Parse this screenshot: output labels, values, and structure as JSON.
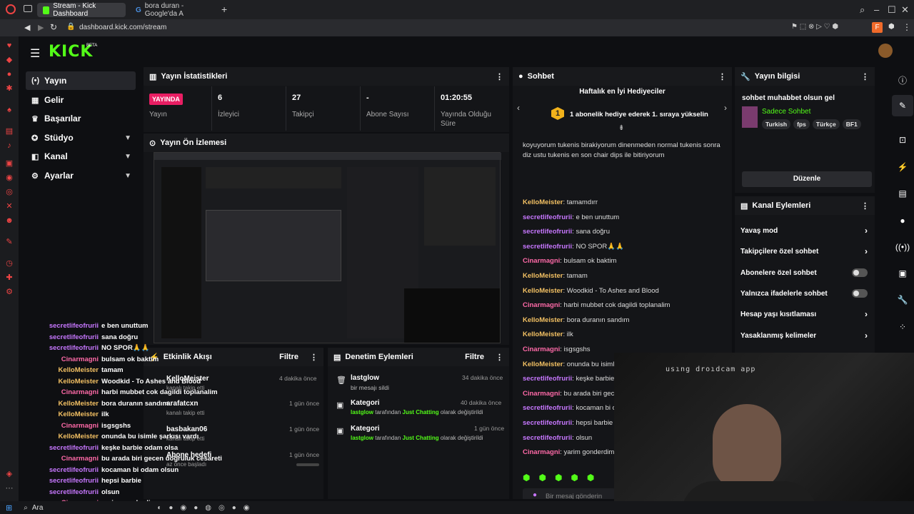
{
  "browser": {
    "tabs": [
      {
        "label": "Stream - Kick Dashboard"
      },
      {
        "label": "bora duran - Google'da A"
      }
    ],
    "url": "dashboard.kick.com/stream",
    "profile_initial": "F"
  },
  "kick": {
    "logo": "KICK",
    "beta": "BETA"
  },
  "nav": [
    {
      "label": "Yayın"
    },
    {
      "label": "Gelir"
    },
    {
      "label": "Başarılar"
    },
    {
      "label": "Stüdyo"
    },
    {
      "label": "Kanal"
    },
    {
      "label": "Ayarlar"
    }
  ],
  "stats": {
    "title": "Yayın İstatistikleri",
    "live_badge": "YAYINDA",
    "live_label": "Yayın",
    "viewers_value": "6",
    "viewers_label": "İzleyici",
    "followers_value": "27",
    "followers_label": "Takipçi",
    "subs_value": "-",
    "subs_label": "Abone Sayısı",
    "uptime_value": "01:20:55",
    "uptime_label": "Yayında Olduğu Süre"
  },
  "preview": {
    "title": "Yayın Ön İzlemesi"
  },
  "activity": {
    "title": "Etkinlik Akışı",
    "filter": "Filtre",
    "items": [
      {
        "user": "KelloMeister",
        "desc": "kanalı takip etti",
        "time": "4 dakika önce"
      },
      {
        "user": "arafatcxn",
        "desc": "kanalı takip etti",
        "time": "1 gün önce"
      },
      {
        "user": "basbakan06",
        "desc": "kanalı takip etti",
        "time": "1 gün önce"
      },
      {
        "user": "Abone hedefi",
        "desc": "az önce başladı",
        "time": "1 gün önce"
      }
    ]
  },
  "moderation": {
    "title": "Denetim Eylemleri",
    "filter": "Filtre",
    "items": [
      {
        "title": "lastglow",
        "desc": "bir mesajı sildi",
        "time": "34 dakika önce"
      },
      {
        "title": "Kategori",
        "user": "lastglow",
        "mid": "tarafından",
        "cat": "Just Chatting",
        "end": "olarak değiştirildi",
        "time": "40 dakika önce"
      },
      {
        "title": "Kategori",
        "user": "lastglow",
        "mid": "tarafından",
        "cat": "Just Chatting",
        "end": "olarak değiştirildi",
        "time": "1 gün önce"
      }
    ]
  },
  "chat": {
    "title": "Sohbet",
    "gifter_title": "Haftalık en İyi Hediyeciler",
    "gifter_rank": "1",
    "gifter_text": "1 abonelik hediye ederek 1. sıraya yükselin",
    "intro": "koyuyorum tukenis birakiyorum dinenmeden normal tukenis sonra diz ustu tukenis en son chair dips ile bitiriyorum",
    "messages": [
      {
        "user": "KelloMeister",
        "text": "tamamdırr",
        "c": "gold"
      },
      {
        "user": "secretlifeofrurii",
        "text": "e ben unuttum",
        "c": "purple"
      },
      {
        "user": "secretlifeofrurii",
        "text": "sana doğru",
        "c": "purple"
      },
      {
        "user": "secretlifeofrurii",
        "text": "NO SPOR🙏🙏",
        "c": "purple"
      },
      {
        "user": "Cinarmagni",
        "text": "bulsam ok baktim",
        "c": "pink"
      },
      {
        "user": "KelloMeister",
        "text": "tamam",
        "c": "gold"
      },
      {
        "user": "KelloMeister",
        "text": "Woodkid - To Ashes and Blood",
        "c": "gold"
      },
      {
        "user": "Cinarmagni",
        "text": "harbi mubbet cok dagildi toplanalim",
        "c": "pink"
      },
      {
        "user": "KelloMeister",
        "text": "bora duranın sandım",
        "c": "gold"
      },
      {
        "user": "KelloMeister",
        "text": "ilk",
        "c": "gold"
      },
      {
        "user": "Cinarmagni",
        "text": "isgsgshs",
        "c": "pink"
      },
      {
        "user": "KelloMeister",
        "text": "onunda bu isimle şarkısı vardı",
        "c": "gold"
      },
      {
        "user": "secretlifeofrurii",
        "text": "keşke barbie odam olsa",
        "c": "purple"
      },
      {
        "user": "Cinarmagni",
        "text": "bu arada biri gecen",
        "c": "pink"
      },
      {
        "user": "secretlifeofrurii",
        "text": "kocaman bi oc",
        "c": "purple"
      },
      {
        "user": "secretlifeofrurii",
        "text": "hepsi barbie",
        "c": "purple"
      },
      {
        "user": "secretlifeofrurii",
        "text": "olsun",
        "c": "purple"
      },
      {
        "user": "Cinarmagni",
        "text": "yarim gonderdim",
        "c": "pink"
      }
    ],
    "input_placeholder": "Bir mesaj gönderin"
  },
  "info": {
    "title": "Yayın bilgisi",
    "stream_title": "sohbet muhabbet olsun gel",
    "category": "Sadece Sohbet",
    "tags": [
      "Turkish",
      "fps",
      "Türkçe",
      "BF1"
    ],
    "edit": "Düzenle"
  },
  "channel_actions": {
    "title": "Kanal Eylemleri",
    "items": [
      {
        "label": "Yavaş mod",
        "kind": "chevron"
      },
      {
        "label": "Takipçilere özel sohbet",
        "kind": "chevron"
      },
      {
        "label": "Abonelere özel sohbet",
        "kind": "toggle"
      },
      {
        "label": "Yalnızca ifadelerle sohbet",
        "kind": "toggle"
      },
      {
        "label": "Hesap yaşı kısıtlaması",
        "kind": "chevron"
      },
      {
        "label": "Yasaklanmış kelimeler",
        "kind": "chevron"
      }
    ]
  },
  "webcam": {
    "mirror_text": "usıng droıdcam app"
  },
  "overlay": [
    {
      "user": "secretlifeofrurii",
      "text": "e ben unuttum",
      "c": "purple"
    },
    {
      "user": "secretlifeofrurii",
      "text": "sana doğru",
      "c": "purple"
    },
    {
      "user": "secretlifeofrurii",
      "text": "NO SPOR🙏🙏",
      "c": "purple"
    },
    {
      "user": "Cinarmagni",
      "text": "bulsam ok baktim",
      "c": "pink"
    },
    {
      "user": "KelloMeister",
      "text": "tamam",
      "c": "gold"
    },
    {
      "user": "KelloMeister",
      "text": "Woodkid - To Ashes and Blood",
      "c": "gold"
    },
    {
      "user": "Cinarmagni",
      "text": "harbi mubbet cok dagildi toplanalim",
      "c": "pink"
    },
    {
      "user": "KelloMeister",
      "text": "bora duranın sandım",
      "c": "gold"
    },
    {
      "user": "KelloMeister",
      "text": "ilk",
      "c": "gold"
    },
    {
      "user": "Cinarmagni",
      "text": "isgsgshs",
      "c": "pink"
    },
    {
      "user": "KelloMeister",
      "text": "onunda bu isimle şarkısı vardı",
      "c": "gold"
    },
    {
      "user": "secretlifeofrurii",
      "text": "keşke barbie odam olsa",
      "c": "purple"
    },
    {
      "user": "Cinarmagni",
      "text": "bu arada biri gecen doğruluk cesareti",
      "c": "pink"
    },
    {
      "user": "secretlifeofrurii",
      "text": "kocaman bi odam olsun",
      "c": "purple"
    },
    {
      "user": "secretlifeofrurii",
      "text": "hepsi barbie",
      "c": "purple"
    },
    {
      "user": "secretlifeofrurii",
      "text": "olsun",
      "c": "purple"
    },
    {
      "user": "Cinarmagni",
      "text": "yarim gonderdim",
      "c": "pink"
    }
  ],
  "taskbar": {
    "search": "Ara"
  },
  "colors": {
    "accent": "#53fc18",
    "live": "#e91e63"
  }
}
